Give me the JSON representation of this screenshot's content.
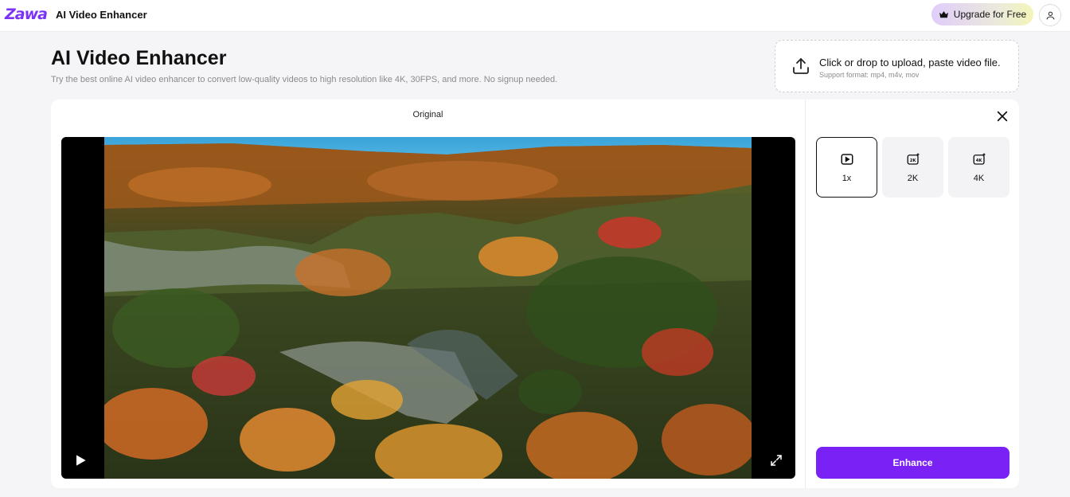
{
  "header": {
    "logo_text": "Zawa",
    "app_name": "AI Video Enhancer",
    "upgrade_label": "Upgrade for Free",
    "upgrade_icon": "crown-icon",
    "profile_icon": "user-icon"
  },
  "intro": {
    "title": "AI Video Enhancer",
    "description": "Try the best online AI video enhancer to convert low-quality videos to high resolution like 4K, 30FPS, and more. No signup needed."
  },
  "upload": {
    "icon": "upload-icon",
    "main_text": "Click or drop to upload, paste video file.",
    "sub_text": "Support format: mp4, m4v, mov"
  },
  "preview": {
    "label": "Original",
    "play_icon": "play-icon",
    "fullscreen_icon": "fullscreen-icon"
  },
  "panel": {
    "close_icon": "close-icon",
    "options": [
      {
        "label": "1x",
        "icon": "play-square-icon",
        "selected": true
      },
      {
        "label": "2K",
        "icon": "2k-icon",
        "selected": false
      },
      {
        "label": "4K",
        "icon": "4k-icon",
        "selected": false
      }
    ],
    "enhance_label": "Enhance"
  },
  "colors": {
    "brand": "#7a22f6",
    "logo": "#7a32f6",
    "page_bg": "#f5f5f7",
    "sky": "#3aa3d8"
  }
}
